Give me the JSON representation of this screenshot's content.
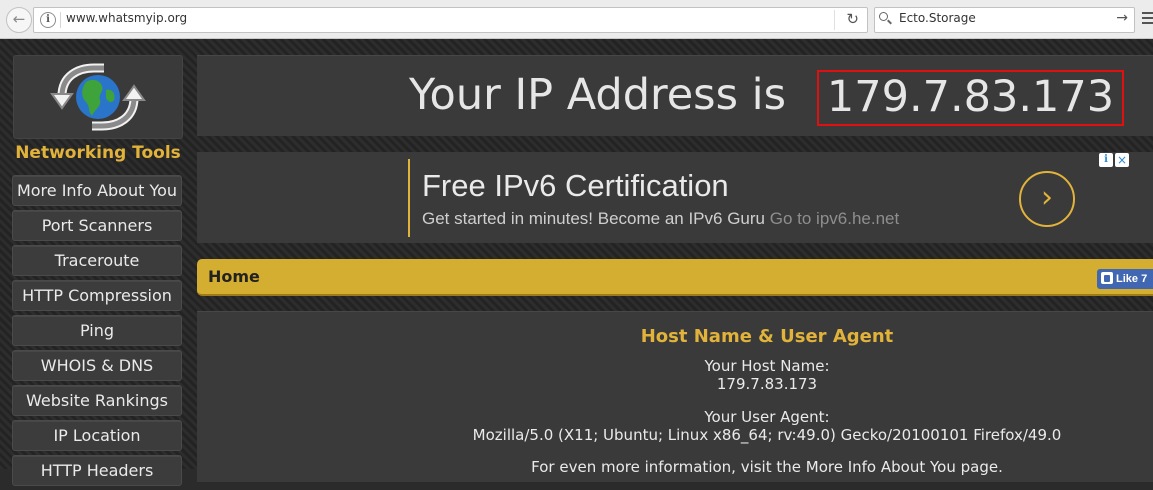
{
  "browser": {
    "url": "www.whatsmyip.org",
    "search_value": "Ecto.Storage"
  },
  "sidebar": {
    "title": "Networking Tools",
    "items": [
      {
        "label": "More Info About You"
      },
      {
        "label": "Port Scanners"
      },
      {
        "label": "Traceroute"
      },
      {
        "label": "HTTP Compression"
      },
      {
        "label": "Ping"
      },
      {
        "label": "WHOIS & DNS"
      },
      {
        "label": "Website Rankings"
      },
      {
        "label": "IP Location"
      },
      {
        "label": "HTTP Headers"
      }
    ]
  },
  "ip": {
    "label": "Your IP Address is",
    "value": "179.7.83.173"
  },
  "ad": {
    "title": "Free IPv6 Certification",
    "desc": "Get started in minutes! Become an IPv6 Guru",
    "link": "Go to ipv6.he.net"
  },
  "breadcrumb": {
    "home": "Home",
    "like": "Like 7"
  },
  "host_info": {
    "title": "Host Name & User Agent",
    "host_label": "Your Host Name:",
    "host_value": "179.7.83.173",
    "ua_label": "Your User Agent:",
    "ua_value": "Mozilla/5.0 (X11; Ubuntu; Linux x86_64; rv:49.0) Gecko/20100101 Firefox/49.0",
    "more_info": "For even more information, visit the More Info About You page."
  },
  "colors": {
    "accent": "#e2b33a",
    "home_bar": "#d4ae30",
    "highlight_border": "#e01010",
    "facebook": "#4267b2"
  }
}
